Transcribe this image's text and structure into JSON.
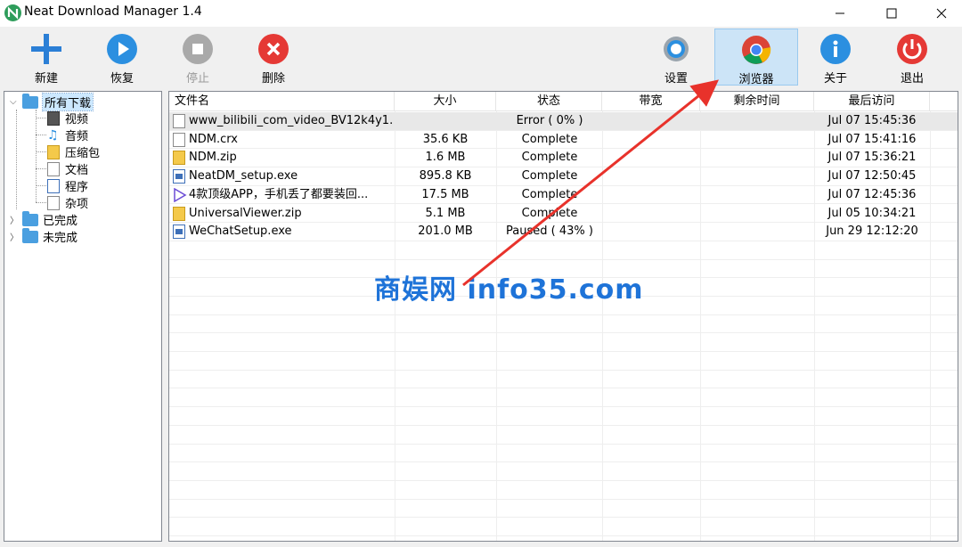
{
  "window": {
    "title": "Neat Download Manager 1.4"
  },
  "toolbar": {
    "new_label": "新建",
    "resume_label": "恢复",
    "stop_label": "停止",
    "delete_label": "删除",
    "settings_label": "设置",
    "browser_label": "浏览器",
    "about_label": "关于",
    "exit_label": "退出"
  },
  "tree": {
    "all": "所有下载",
    "video": "视频",
    "audio": "音频",
    "archive": "压缩包",
    "document": "文档",
    "program": "程序",
    "misc": "杂项",
    "completed": "已完成",
    "incomplete": "未完成"
  },
  "columns": {
    "name": "文件名",
    "size": "大小",
    "status": "状态",
    "bandwidth": "带宽",
    "remaining": "剩余时间",
    "last_access": "最后访问"
  },
  "rows": [
    {
      "name": "www_bilibili_com_video_BV12k4y1...",
      "size": "",
      "status": "Error ( 0% )",
      "last": "Jul 07 15:45:36",
      "icon": "blank-file-icon"
    },
    {
      "name": "NDM.crx",
      "size": "35.6 KB",
      "status": "Complete",
      "last": "Jul 07 15:41:16",
      "icon": "blank-file-icon"
    },
    {
      "name": "NDM.zip",
      "size": "1.6 MB",
      "status": "Complete",
      "last": "Jul 07 15:36:21",
      "icon": "zip-file-icon"
    },
    {
      "name": "NeatDM_setup.exe",
      "size": "895.8 KB",
      "status": "Complete",
      "last": "Jul 07 12:50:45",
      "icon": "exe-file-icon"
    },
    {
      "name": "4款顶级APP，手机丢了都要装回...",
      "size": "17.5 MB",
      "status": "Complete",
      "last": "Jul 07 12:45:36",
      "icon": "video-file-icon"
    },
    {
      "name": "UniversalViewer.zip",
      "size": "5.1 MB",
      "status": "Complete",
      "last": "Jul 05 10:34:21",
      "icon": "zip-file-icon"
    },
    {
      "name": "WeChatSetup.exe",
      "size": "201.0 MB",
      "status": "Paused ( 43% )",
      "last": "Jun 29 12:12:20",
      "icon": "exe-file-icon"
    }
  ],
  "watermark": "商娱网 info35.com",
  "colors": {
    "accent_blue": "#1e73d8",
    "arrow_red": "#e8322b",
    "selected_toolbar": "#cce4f7"
  }
}
